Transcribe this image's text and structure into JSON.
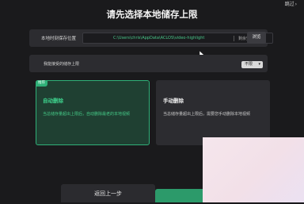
{
  "header": {
    "skip_label": "跳过",
    "title": "请先选择本地储存上限"
  },
  "storage_path": {
    "label": "本地时刻保存位置",
    "path": "C:\\Users\\chris\\AppData\\ACLOS\\video-highlight",
    "free_space": "剩余空间 52G",
    "browse_label": "浏览"
  },
  "storage_limit": {
    "label": "我能接受的储存上限",
    "selected": "不限"
  },
  "options": [
    {
      "badge": "推荐",
      "title": "自动删除",
      "description": "当总储存量超出上限后，自动删除最老的本地视频",
      "selected": true
    },
    {
      "title": "手动删除",
      "description": "当总储存量超出上限后，需要您手动删除本地视频",
      "selected": false
    }
  ],
  "footer": {
    "prev_label": "返回上一步"
  },
  "colors": {
    "accent": "#2fb078",
    "background": "#1a1a1c",
    "panel": "#2c2c30"
  }
}
